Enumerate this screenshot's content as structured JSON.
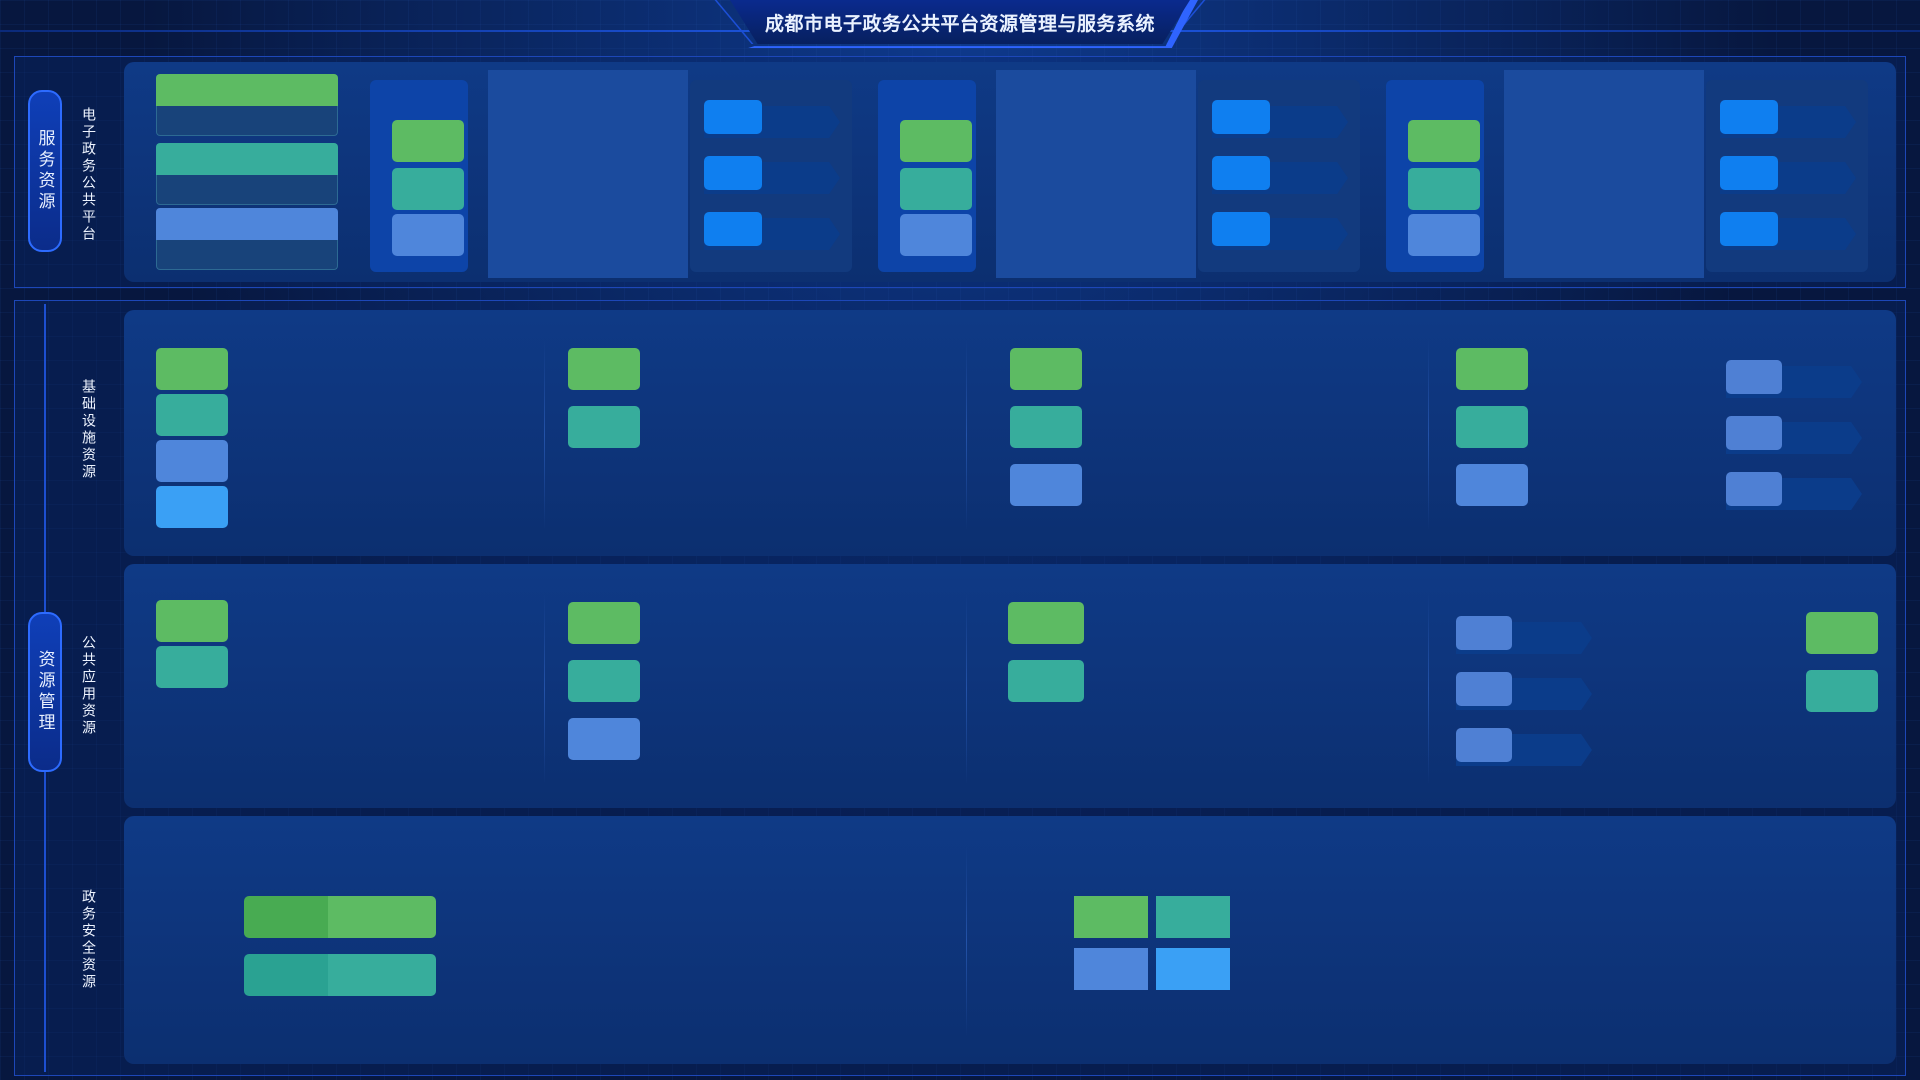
{
  "header": {
    "title": "成都市电子政务公共平台资源管理与服务系统"
  },
  "sections": [
    {
      "key": "service",
      "group_label": "服务资源",
      "rows": [
        {
          "label": "电子政务公共平台"
        }
      ]
    },
    {
      "key": "resource",
      "group_label": "资源管理",
      "rows": [
        {
          "label": "基础设施资源"
        },
        {
          "label": "公共应用资源"
        },
        {
          "label": "政务安全资源"
        }
      ]
    }
  ],
  "colors": {
    "background": "#081a45",
    "accent": "#2f64ff",
    "green": "#5dbb63",
    "teal": "#37ad9c",
    "periwinkle": "#4f86db",
    "sky": "#3aa0f5",
    "arrow_blue": "#0f7ff0"
  }
}
